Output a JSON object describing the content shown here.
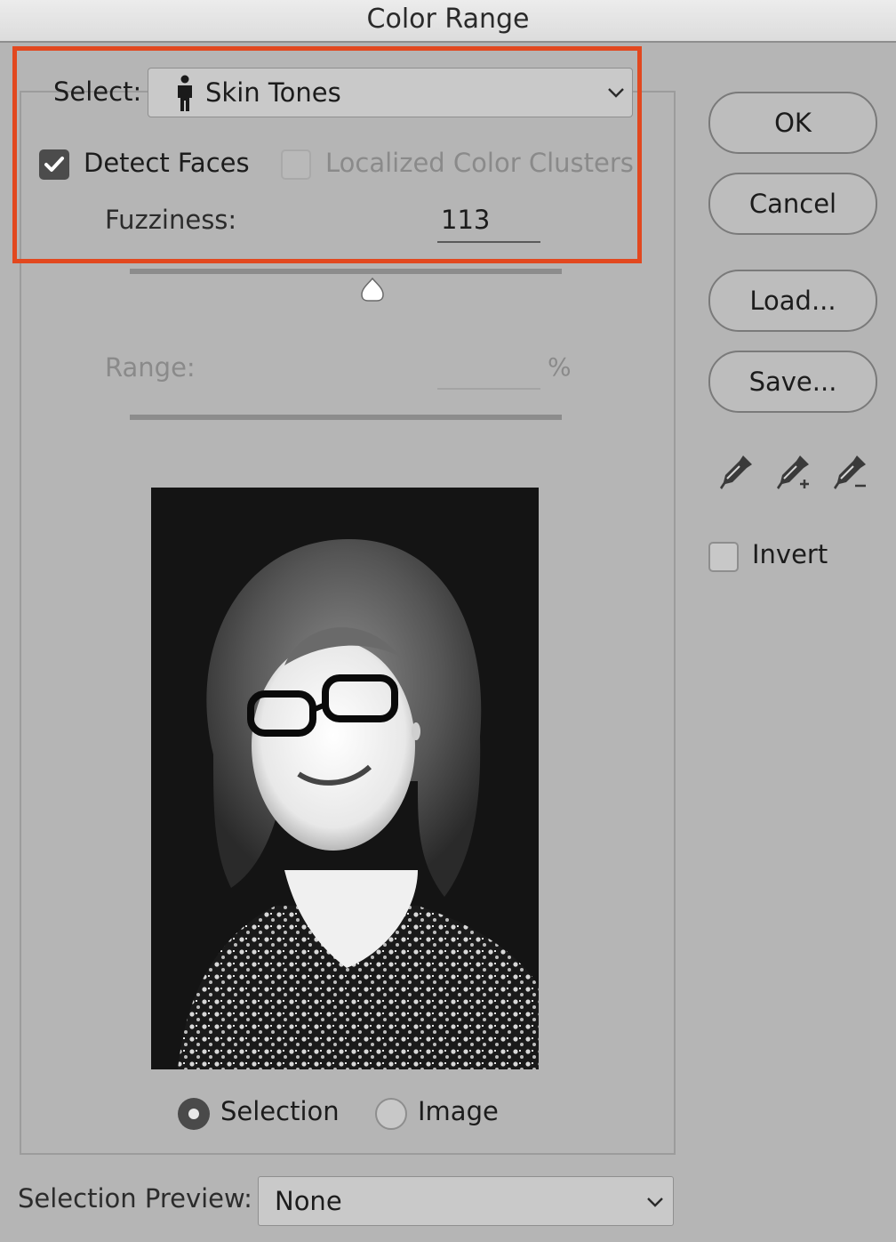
{
  "window": {
    "title": "Color Range"
  },
  "select": {
    "label": "Select:",
    "value": "Skin Tones",
    "icon": "person-icon"
  },
  "options": {
    "detect_faces": {
      "label": "Detect Faces",
      "checked": true
    },
    "localized_color_clusters": {
      "label": "Localized Color Clusters",
      "checked": false,
      "enabled": false
    }
  },
  "fuzziness": {
    "label": "Fuzziness:",
    "value": "113"
  },
  "range": {
    "label": "Range:",
    "value": "",
    "unit": "%",
    "enabled": false
  },
  "preview_mode": {
    "options": [
      "Selection",
      "Image"
    ],
    "selected": "Selection",
    "selection_label": "Selection",
    "image_label": "Image"
  },
  "buttons": {
    "ok": "OK",
    "cancel": "Cancel",
    "load": "Load...",
    "save": "Save..."
  },
  "eyedroppers": [
    "eyedropper-icon",
    "eyedropper-add-icon",
    "eyedropper-subtract-icon"
  ],
  "invert": {
    "label": "Invert",
    "checked": false
  },
  "selection_preview": {
    "label": "Selection Preview:",
    "value": "None"
  },
  "colors": {
    "highlight": "#e2481f",
    "dialog_bg": "#b5b5b5"
  }
}
